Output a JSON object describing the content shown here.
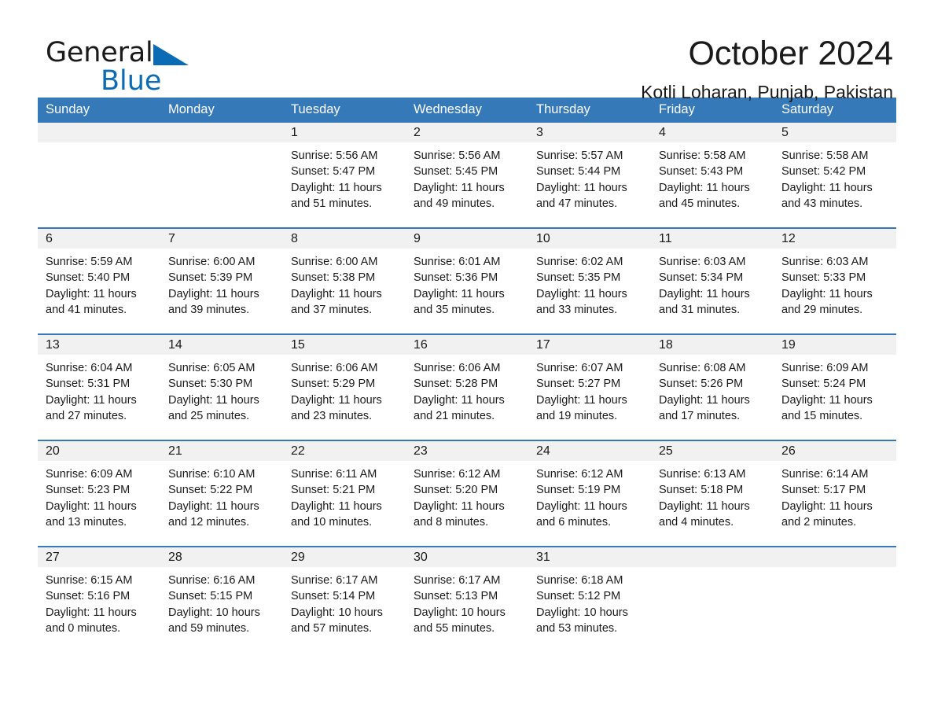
{
  "brand": {
    "name_part1": "General",
    "name_part2": "Blue",
    "logo_icon": "blue-triangle-icon",
    "accent_color": "#0b6cb5"
  },
  "header": {
    "month_title": "October 2024",
    "location": "Kotli Loharan, Punjab, Pakistan"
  },
  "theme": {
    "header_blue": "#3579b8",
    "daynum_gray": "#f1f1f1",
    "text_color": "#1a1a1a"
  },
  "calendar": {
    "weekday_headers": [
      "Sunday",
      "Monday",
      "Tuesday",
      "Wednesday",
      "Thursday",
      "Friday",
      "Saturday"
    ],
    "weeks": [
      [
        {
          "day": "",
          "sunrise": "",
          "sunset": "",
          "daylight": ""
        },
        {
          "day": "",
          "sunrise": "",
          "sunset": "",
          "daylight": ""
        },
        {
          "day": "1",
          "sunrise": "Sunrise: 5:56 AM",
          "sunset": "Sunset: 5:47 PM",
          "daylight": "Daylight: 11 hours and 51 minutes."
        },
        {
          "day": "2",
          "sunrise": "Sunrise: 5:56 AM",
          "sunset": "Sunset: 5:45 PM",
          "daylight": "Daylight: 11 hours and 49 minutes."
        },
        {
          "day": "3",
          "sunrise": "Sunrise: 5:57 AM",
          "sunset": "Sunset: 5:44 PM",
          "daylight": "Daylight: 11 hours and 47 minutes."
        },
        {
          "day": "4",
          "sunrise": "Sunrise: 5:58 AM",
          "sunset": "Sunset: 5:43 PM",
          "daylight": "Daylight: 11 hours and 45 minutes."
        },
        {
          "day": "5",
          "sunrise": "Sunrise: 5:58 AM",
          "sunset": "Sunset: 5:42 PM",
          "daylight": "Daylight: 11 hours and 43 minutes."
        }
      ],
      [
        {
          "day": "6",
          "sunrise": "Sunrise: 5:59 AM",
          "sunset": "Sunset: 5:40 PM",
          "daylight": "Daylight: 11 hours and 41 minutes."
        },
        {
          "day": "7",
          "sunrise": "Sunrise: 6:00 AM",
          "sunset": "Sunset: 5:39 PM",
          "daylight": "Daylight: 11 hours and 39 minutes."
        },
        {
          "day": "8",
          "sunrise": "Sunrise: 6:00 AM",
          "sunset": "Sunset: 5:38 PM",
          "daylight": "Daylight: 11 hours and 37 minutes."
        },
        {
          "day": "9",
          "sunrise": "Sunrise: 6:01 AM",
          "sunset": "Sunset: 5:36 PM",
          "daylight": "Daylight: 11 hours and 35 minutes."
        },
        {
          "day": "10",
          "sunrise": "Sunrise: 6:02 AM",
          "sunset": "Sunset: 5:35 PM",
          "daylight": "Daylight: 11 hours and 33 minutes."
        },
        {
          "day": "11",
          "sunrise": "Sunrise: 6:03 AM",
          "sunset": "Sunset: 5:34 PM",
          "daylight": "Daylight: 11 hours and 31 minutes."
        },
        {
          "day": "12",
          "sunrise": "Sunrise: 6:03 AM",
          "sunset": "Sunset: 5:33 PM",
          "daylight": "Daylight: 11 hours and 29 minutes."
        }
      ],
      [
        {
          "day": "13",
          "sunrise": "Sunrise: 6:04 AM",
          "sunset": "Sunset: 5:31 PM",
          "daylight": "Daylight: 11 hours and 27 minutes."
        },
        {
          "day": "14",
          "sunrise": "Sunrise: 6:05 AM",
          "sunset": "Sunset: 5:30 PM",
          "daylight": "Daylight: 11 hours and 25 minutes."
        },
        {
          "day": "15",
          "sunrise": "Sunrise: 6:06 AM",
          "sunset": "Sunset: 5:29 PM",
          "daylight": "Daylight: 11 hours and 23 minutes."
        },
        {
          "day": "16",
          "sunrise": "Sunrise: 6:06 AM",
          "sunset": "Sunset: 5:28 PM",
          "daylight": "Daylight: 11 hours and 21 minutes."
        },
        {
          "day": "17",
          "sunrise": "Sunrise: 6:07 AM",
          "sunset": "Sunset: 5:27 PM",
          "daylight": "Daylight: 11 hours and 19 minutes."
        },
        {
          "day": "18",
          "sunrise": "Sunrise: 6:08 AM",
          "sunset": "Sunset: 5:26 PM",
          "daylight": "Daylight: 11 hours and 17 minutes."
        },
        {
          "day": "19",
          "sunrise": "Sunrise: 6:09 AM",
          "sunset": "Sunset: 5:24 PM",
          "daylight": "Daylight: 11 hours and 15 minutes."
        }
      ],
      [
        {
          "day": "20",
          "sunrise": "Sunrise: 6:09 AM",
          "sunset": "Sunset: 5:23 PM",
          "daylight": "Daylight: 11 hours and 13 minutes."
        },
        {
          "day": "21",
          "sunrise": "Sunrise: 6:10 AM",
          "sunset": "Sunset: 5:22 PM",
          "daylight": "Daylight: 11 hours and 12 minutes."
        },
        {
          "day": "22",
          "sunrise": "Sunrise: 6:11 AM",
          "sunset": "Sunset: 5:21 PM",
          "daylight": "Daylight: 11 hours and 10 minutes."
        },
        {
          "day": "23",
          "sunrise": "Sunrise: 6:12 AM",
          "sunset": "Sunset: 5:20 PM",
          "daylight": "Daylight: 11 hours and 8 minutes."
        },
        {
          "day": "24",
          "sunrise": "Sunrise: 6:12 AM",
          "sunset": "Sunset: 5:19 PM",
          "daylight": "Daylight: 11 hours and 6 minutes."
        },
        {
          "day": "25",
          "sunrise": "Sunrise: 6:13 AM",
          "sunset": "Sunset: 5:18 PM",
          "daylight": "Daylight: 11 hours and 4 minutes."
        },
        {
          "day": "26",
          "sunrise": "Sunrise: 6:14 AM",
          "sunset": "Sunset: 5:17 PM",
          "daylight": "Daylight: 11 hours and 2 minutes."
        }
      ],
      [
        {
          "day": "27",
          "sunrise": "Sunrise: 6:15 AM",
          "sunset": "Sunset: 5:16 PM",
          "daylight": "Daylight: 11 hours and 0 minutes."
        },
        {
          "day": "28",
          "sunrise": "Sunrise: 6:16 AM",
          "sunset": "Sunset: 5:15 PM",
          "daylight": "Daylight: 10 hours and 59 minutes."
        },
        {
          "day": "29",
          "sunrise": "Sunrise: 6:17 AM",
          "sunset": "Sunset: 5:14 PM",
          "daylight": "Daylight: 10 hours and 57 minutes."
        },
        {
          "day": "30",
          "sunrise": "Sunrise: 6:17 AM",
          "sunset": "Sunset: 5:13 PM",
          "daylight": "Daylight: 10 hours and 55 minutes."
        },
        {
          "day": "31",
          "sunrise": "Sunrise: 6:18 AM",
          "sunset": "Sunset: 5:12 PM",
          "daylight": "Daylight: 10 hours and 53 minutes."
        },
        {
          "day": "",
          "sunrise": "",
          "sunset": "",
          "daylight": ""
        },
        {
          "day": "",
          "sunrise": "",
          "sunset": "",
          "daylight": ""
        }
      ]
    ]
  }
}
